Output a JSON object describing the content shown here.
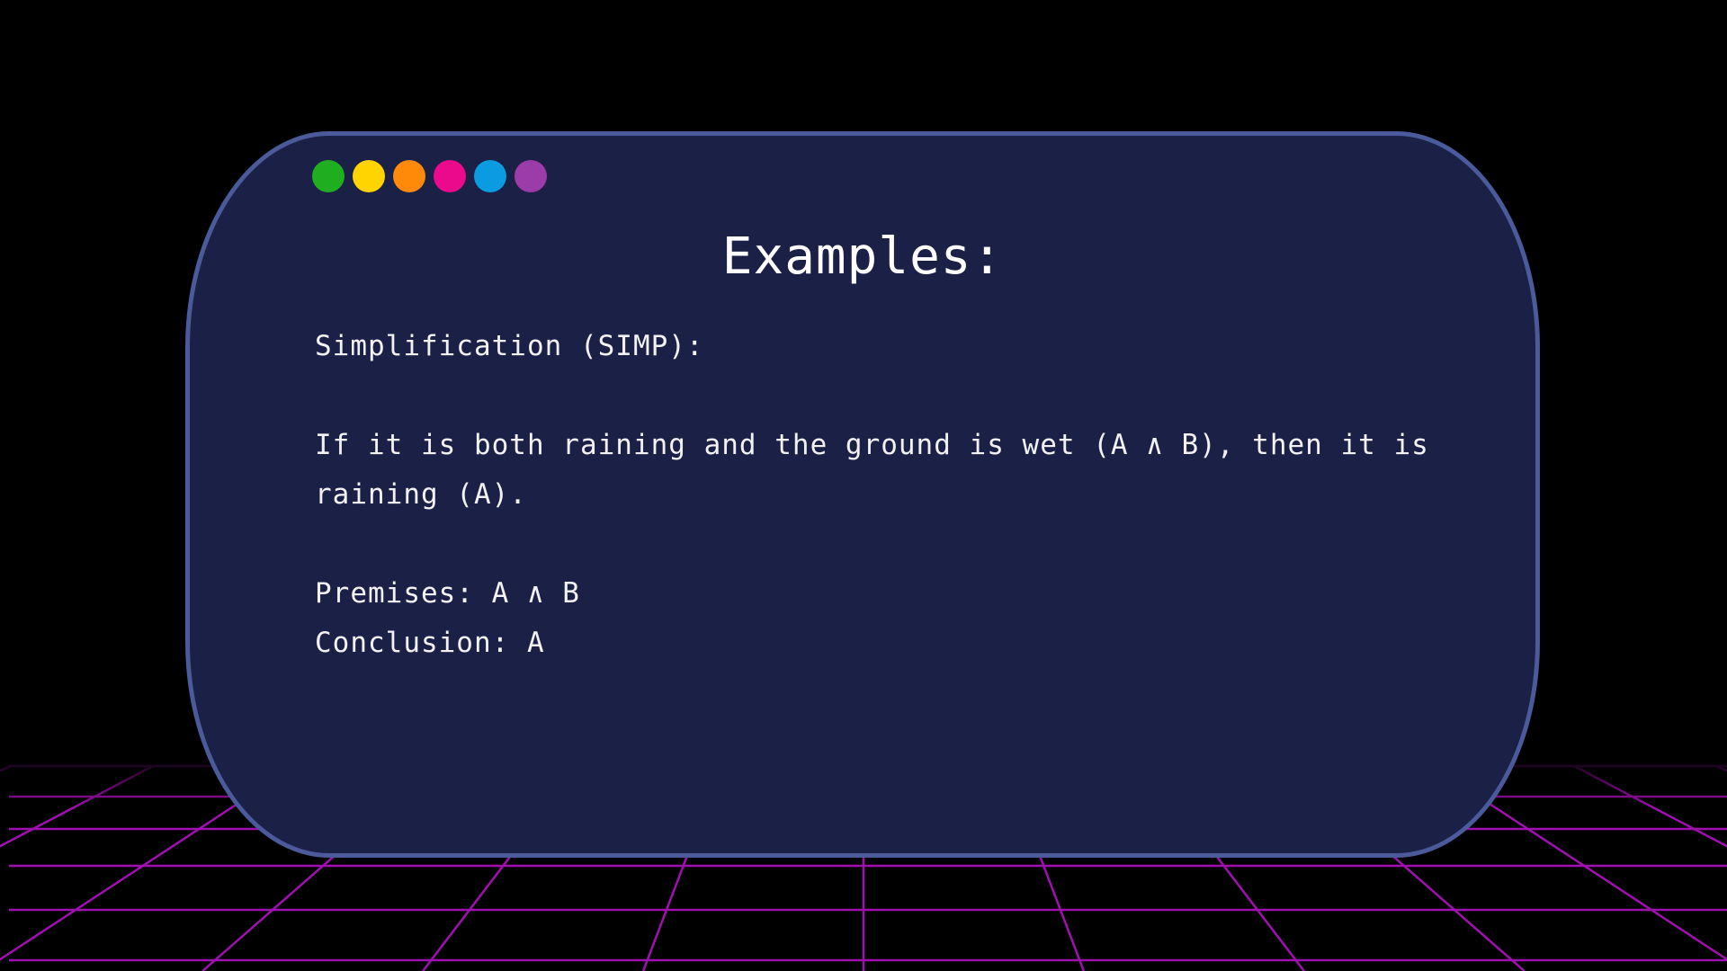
{
  "slide": {
    "title": "Examples:",
    "heading": "Simplification (SIMP):",
    "example": "If it is both raining and the ground is wet (A ∧ B), then it is raining (A).",
    "premises": "Premises: A ∧ B",
    "conclusion": "Conclusion: A"
  },
  "window_dots": [
    {
      "name": "green",
      "color": "#1fae1f"
    },
    {
      "name": "yellow",
      "color": "#ffd400"
    },
    {
      "name": "orange",
      "color": "#ff8a0a"
    },
    {
      "name": "pink",
      "color": "#ec0a8c"
    },
    {
      "name": "blue",
      "color": "#0a9be0"
    },
    {
      "name": "purple",
      "color": "#9c3ca8"
    }
  ],
  "colors": {
    "background": "#000000",
    "card": "#1b2046",
    "card_border": "#4a5a9a",
    "grid": "#a010b0"
  }
}
